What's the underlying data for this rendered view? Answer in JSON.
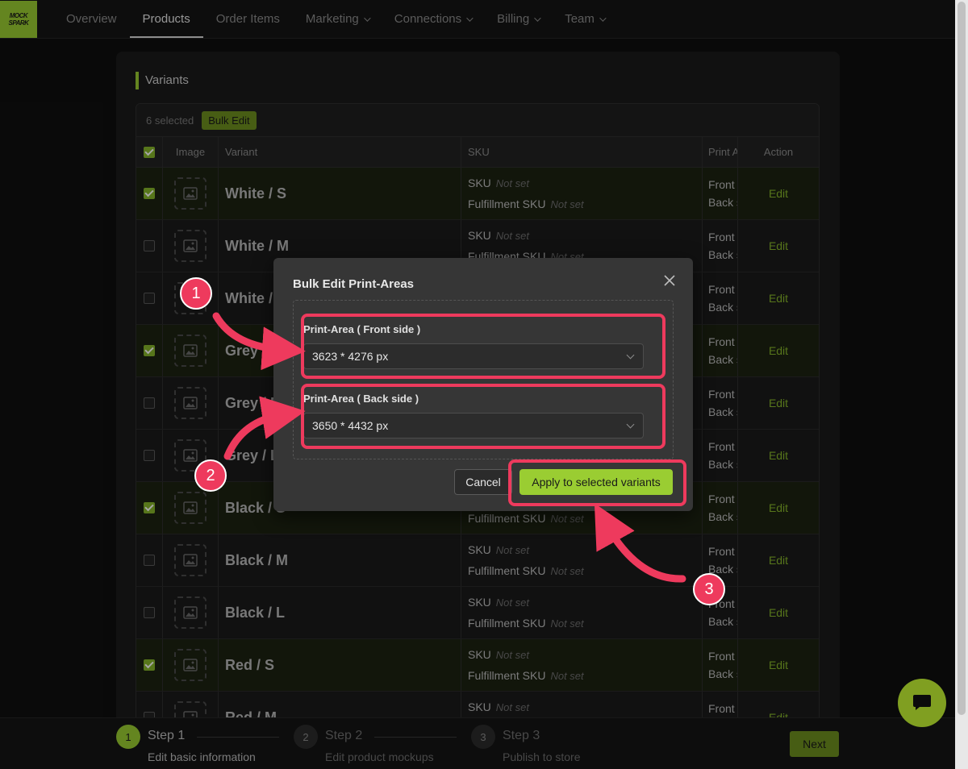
{
  "nav": {
    "logo_line1": "MOCK",
    "logo_line2": "SPARK",
    "items": [
      {
        "label": "Overview",
        "active": false,
        "dropdown": false
      },
      {
        "label": "Products",
        "active": true,
        "dropdown": false
      },
      {
        "label": "Order Items",
        "active": false,
        "dropdown": false
      },
      {
        "label": "Marketing",
        "active": false,
        "dropdown": true
      },
      {
        "label": "Connections",
        "active": false,
        "dropdown": true
      },
      {
        "label": "Billing",
        "active": false,
        "dropdown": true
      },
      {
        "label": "Team",
        "active": false,
        "dropdown": true
      }
    ]
  },
  "section": {
    "title": "Variants"
  },
  "table": {
    "selected_text": "6 selected",
    "bulk_edit_label": "Bulk Edit",
    "headers": {
      "image": "Image",
      "variant": "Variant",
      "sku": "SKU",
      "print": "Print Area",
      "action": "Action"
    },
    "sku_label": "SKU",
    "fulfillment_label": "Fulfillment SKU",
    "not_set": "Not set",
    "front_label": "Front side",
    "back_label": "Back side",
    "edit_label": "Edit",
    "rows": [
      {
        "variant": "White / S",
        "selected": true
      },
      {
        "variant": "White / M",
        "selected": false
      },
      {
        "variant": "White / L",
        "selected": false
      },
      {
        "variant": "Grey / S",
        "selected": true
      },
      {
        "variant": "Grey / M",
        "selected": false
      },
      {
        "variant": "Grey / L",
        "selected": false
      },
      {
        "variant": "Black / S",
        "selected": true
      },
      {
        "variant": "Black / M",
        "selected": false
      },
      {
        "variant": "Black / L",
        "selected": false
      },
      {
        "variant": "Red / S",
        "selected": true
      },
      {
        "variant": "Red / M",
        "selected": false
      }
    ]
  },
  "modal": {
    "title": "Bulk Edit Print-Areas",
    "front_label": "Print-Area ( Front side )",
    "front_value": "3623 * 4276 px",
    "back_label": "Print-Area ( Back side )",
    "back_value": "3650 * 4432 px",
    "cancel_label": "Cancel",
    "apply_label": "Apply to selected variants"
  },
  "annotations": {
    "one": "1",
    "two": "2",
    "three": "3",
    "color": "#ee3a5d"
  },
  "footer": {
    "steps": [
      {
        "num": "1",
        "title": "Step 1",
        "desc": "Edit basic information",
        "active": true
      },
      {
        "num": "2",
        "title": "Step 2",
        "desc": "Edit product mockups",
        "active": false
      },
      {
        "num": "3",
        "title": "Step 3",
        "desc": "Publish to store",
        "active": false
      }
    ],
    "next_label": "Next"
  },
  "colors": {
    "accent": "#9acd32",
    "highlight": "#ee3a5d"
  }
}
